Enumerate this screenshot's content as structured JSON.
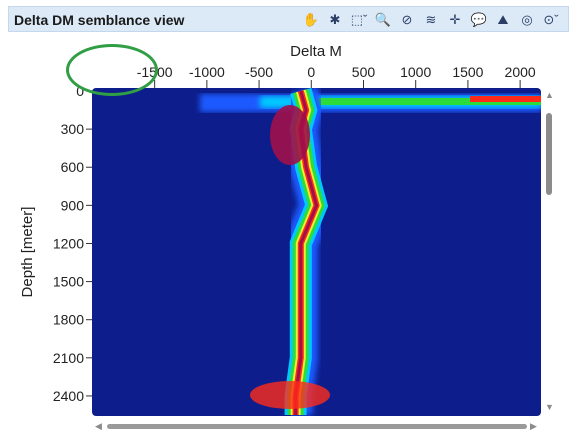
{
  "panel": {
    "title": "Delta DM semblance view"
  },
  "toolbar": [
    {
      "icon": "pan-hand-icon",
      "glyph": "✋"
    },
    {
      "icon": "settings-icon",
      "glyph": "✱"
    },
    {
      "icon": "select-dropdown-icon",
      "glyph": "⬚ˇ"
    },
    {
      "icon": "zoom-icon",
      "glyph": "🔍"
    },
    {
      "icon": "pick-icon",
      "glyph": "⊘"
    },
    {
      "icon": "layers-icon",
      "glyph": "≋"
    },
    {
      "icon": "crosshair-icon",
      "glyph": "✛"
    },
    {
      "icon": "comment-icon",
      "glyph": "💬"
    },
    {
      "icon": "image-export-icon",
      "glyph": "⛰"
    },
    {
      "icon": "print-icon",
      "glyph": "◎"
    },
    {
      "icon": "compass-dropdown-icon",
      "glyph": "⊙ˇ"
    }
  ],
  "chart_data": {
    "type": "heatmap",
    "xlabel": "Delta M",
    "ylabel": "Depth [meter]",
    "xlim": [
      -2100,
      2200
    ],
    "ylim": [
      0,
      2550
    ],
    "x_ticks": [
      -1500,
      -1000,
      -500,
      0,
      500,
      1000,
      1500,
      2000
    ],
    "y_ticks": [
      0,
      300,
      600,
      900,
      1200,
      1500,
      1800,
      2100,
      2400
    ],
    "colormap": [
      "#0d1e8c",
      "#1e5aff",
      "#00c8ff",
      "#2bdc3a",
      "#e8f030",
      "#ff2a1a",
      "#a0104a"
    ],
    "ridge_center": [
      {
        "depth": 0,
        "delta_m": -100
      },
      {
        "depth": 150,
        "delta_m": -50
      },
      {
        "depth": 300,
        "delta_m": -100
      },
      {
        "depth": 600,
        "delta_m": -50
      },
      {
        "depth": 900,
        "delta_m": 50
      },
      {
        "depth": 1200,
        "delta_m": -100
      },
      {
        "depth": 1500,
        "delta_m": -100
      },
      {
        "depth": 1800,
        "delta_m": -100
      },
      {
        "depth": 2100,
        "delta_m": -100
      },
      {
        "depth": 2400,
        "delta_m": -150
      },
      {
        "depth": 2550,
        "delta_m": -150
      }
    ]
  },
  "annotation": {
    "highlight": "green-ellipse"
  }
}
